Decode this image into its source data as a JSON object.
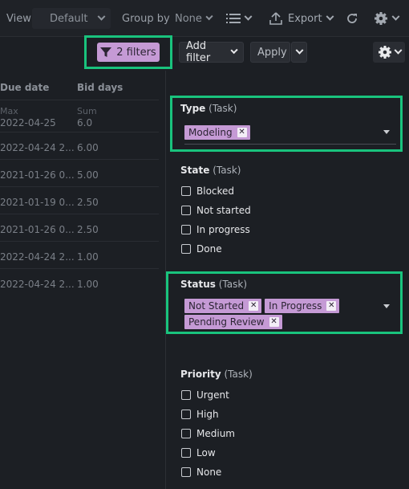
{
  "toolbar": {
    "view_label": "View",
    "view_value": "Default",
    "groupby_label": "Group by",
    "groupby_value": "None",
    "export_label": "Export"
  },
  "filterbar": {
    "filters_label": "2 filters",
    "add_filter_label": "Add filter",
    "apply_label": "Apply"
  },
  "table": {
    "columns": [
      "Due date",
      "Bid days"
    ],
    "aggregate": {
      "due_label": "Max",
      "due_value": "2022-04-25",
      "bid_label": "Sum",
      "bid_value": "6.0"
    },
    "rows": [
      {
        "due": "2022-04-24 2...",
        "bid": "6.00"
      },
      {
        "due": "2021-01-26 0...",
        "bid": "5.00"
      },
      {
        "due": "2021-01-19 0...",
        "bid": "2.50"
      },
      {
        "due": "2021-01-26 0...",
        "bid": "2.50"
      },
      {
        "due": "2022-04-24 2...",
        "bid": "1.00"
      },
      {
        "due": "2022-04-24 2...",
        "bid": "1.00"
      }
    ]
  },
  "panel": {
    "type": {
      "title": "Type",
      "suffix": "(Task)",
      "tags": [
        "Modeling"
      ]
    },
    "state": {
      "title": "State",
      "suffix": "(Task)",
      "options": [
        "Blocked",
        "Not started",
        "In progress",
        "Done"
      ]
    },
    "status": {
      "title": "Status",
      "suffix": "(Task)",
      "tags": [
        "Not Started",
        "In Progress",
        "Pending Review"
      ]
    },
    "priority": {
      "title": "Priority",
      "suffix": "(Task)",
      "options": [
        "Urgent",
        "High",
        "Medium",
        "Low",
        "None"
      ]
    }
  },
  "colors": {
    "highlight": "#19c37d",
    "tag": "#c59ad5",
    "background": "#1c1f24"
  }
}
